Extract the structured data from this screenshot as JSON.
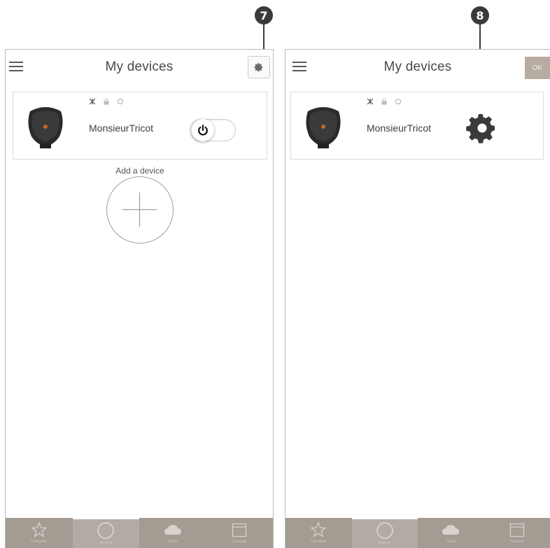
{
  "callouts": {
    "left": "7",
    "right": "8"
  },
  "screens": {
    "left": {
      "title": "My devices",
      "device": {
        "name": "MonsieurTricot",
        "power": "on"
      },
      "add_label": "Add a device"
    },
    "right": {
      "title": "My devices",
      "ok_label": "OK",
      "device": {
        "name": "MonsieurTricot"
      }
    }
  },
  "tabbar": {
    "tabs": [
      {
        "icon": "star-icon",
        "label": "Favourites"
      },
      {
        "icon": "circle-icon",
        "label": "Devices"
      },
      {
        "icon": "cloud-icon",
        "label": "Cloud"
      },
      {
        "icon": "calendar-icon",
        "label": "Calendar"
      }
    ],
    "active_index": 1
  },
  "colors": {
    "tabbar": "#a49b93",
    "ok_button": "#b7aca2",
    "callout": "#3a3a3a"
  }
}
